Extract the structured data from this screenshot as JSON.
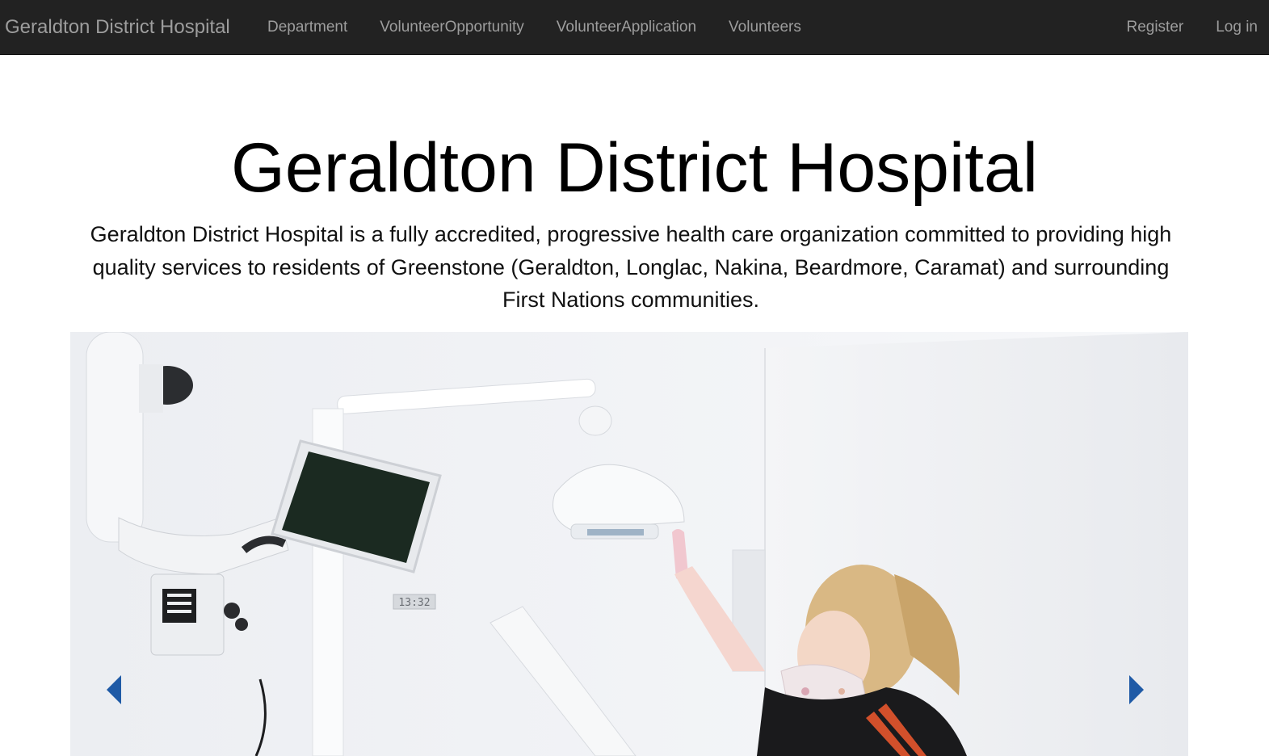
{
  "navbar": {
    "brand": "Geraldton District Hospital",
    "links": [
      {
        "label": "Department"
      },
      {
        "label": "VolunteerOpportunity"
      },
      {
        "label": "VolunteerApplication"
      },
      {
        "label": "Volunteers"
      }
    ],
    "auth": {
      "register": "Register",
      "login": "Log in"
    }
  },
  "hero": {
    "title": "Geraldton District Hospital",
    "description": "Geraldton District Hospital is a fully accredited, progressive health care organization committed to providing high quality services to residents of Greenstone (Geraldton, Longlac, Nakina, Beardmore, Caramat) and surrounding First Nations communities."
  },
  "carousel": {
    "monitor_clock": "13:32",
    "prev_icon": "chevron-left-icon",
    "next_icon": "chevron-right-icon",
    "control_color": "#1f5aa6"
  },
  "colors": {
    "navbar_bg": "#222222",
    "nav_text": "#9d9d9d"
  }
}
